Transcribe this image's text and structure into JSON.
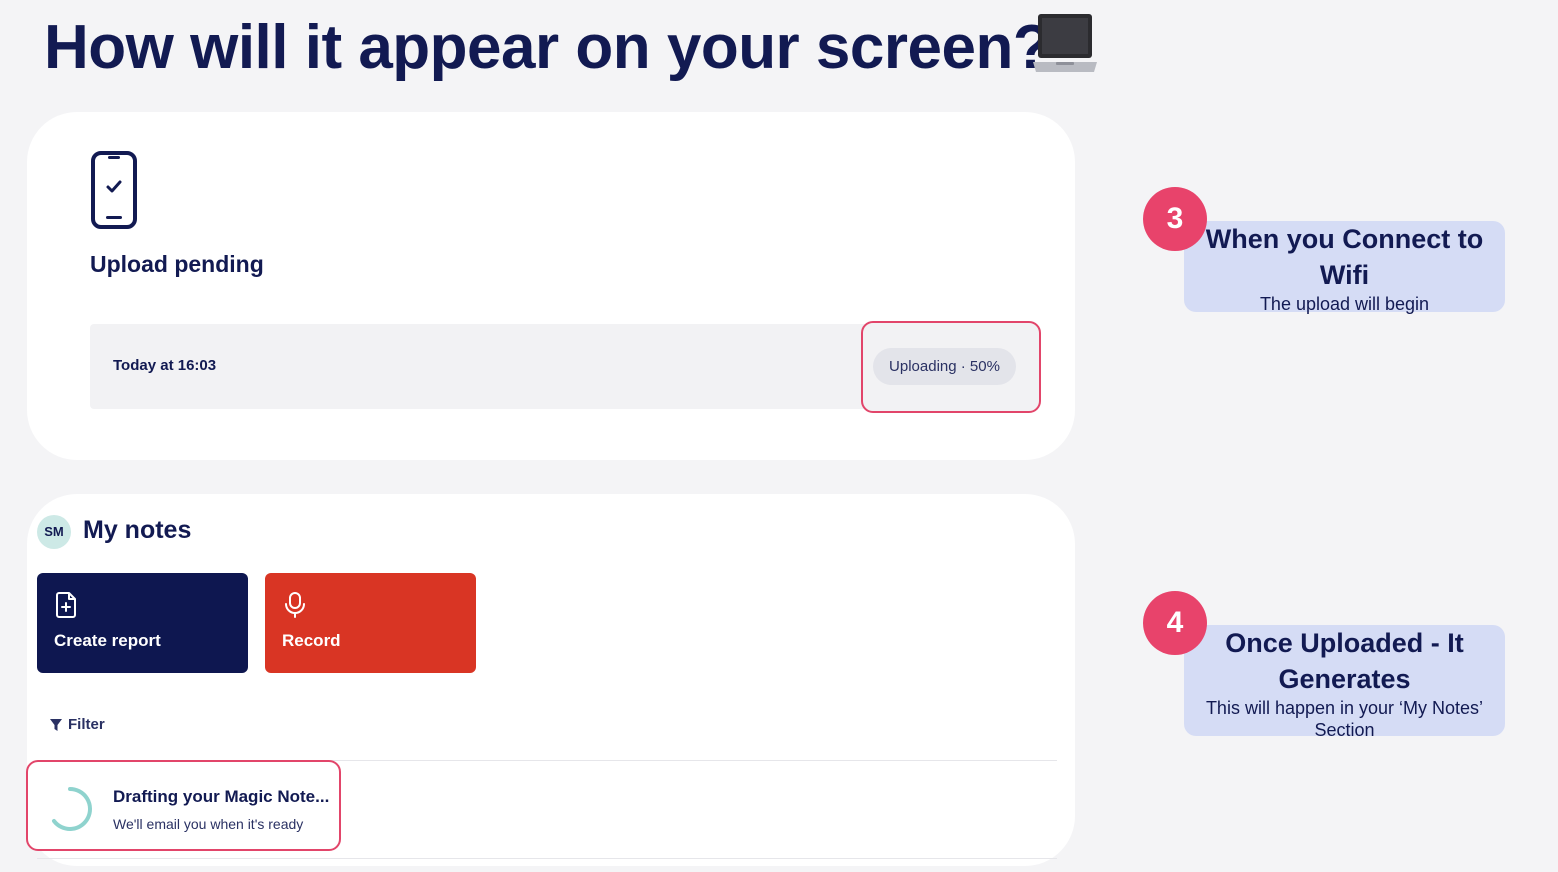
{
  "heading": {
    "title": "How will it appear on your screen?",
    "icon": "laptop-icon"
  },
  "upload_card": {
    "status_title": "Upload pending",
    "timestamp": "Today at 16:03",
    "progress_label": "Uploading · 50%",
    "progress_percent": 50
  },
  "notes_card": {
    "avatar_initials": "SM",
    "title": "My notes",
    "actions": [
      {
        "label": "Create report",
        "icon": "file-plus-icon",
        "color": "#0e1750"
      },
      {
        "label": "Record",
        "icon": "microphone-icon",
        "color": "#d93524"
      }
    ],
    "filter_label": "Filter",
    "drafting": {
      "title": "Drafting your Magic Note...",
      "subtitle": "We'll email you when it's ready"
    }
  },
  "callouts": [
    {
      "number": "3",
      "heading": "When you Connect to Wifi",
      "text": "The upload will begin"
    },
    {
      "number": "4",
      "heading": "Once Uploaded - It Generates",
      "text": "This will happen in your ‘My Notes’ Section"
    }
  ],
  "colors": {
    "navy": "#121a52",
    "highlight": "#e2456a",
    "badge": "#e8436b",
    "callout_bg": "#d5dcf5",
    "record_red": "#d93524"
  }
}
